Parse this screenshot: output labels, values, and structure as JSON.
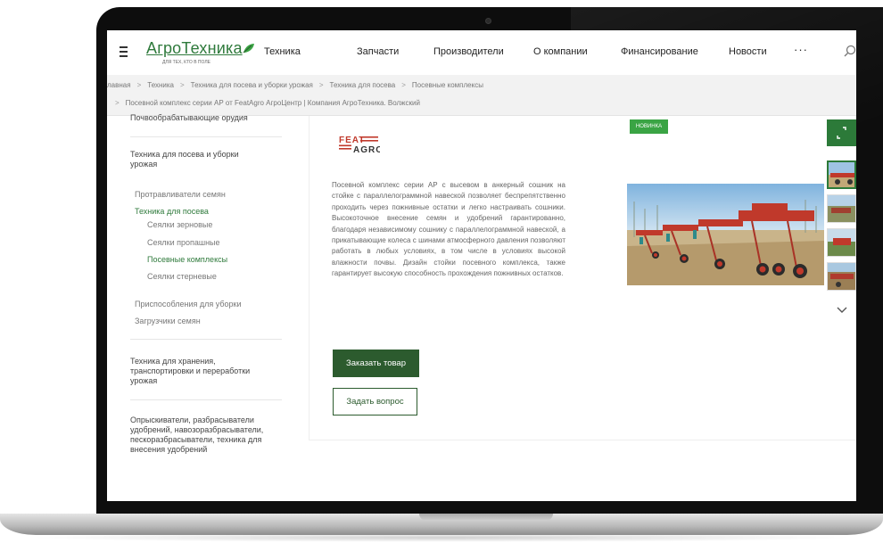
{
  "logo": {
    "name": "АгроТехника",
    "tagline": "ДЛЯ ТЕХ, КТО В ПОЛЕ"
  },
  "nav": {
    "items": [
      "Техника",
      "Запчасти",
      "Производители",
      "О компании",
      "Финансирование",
      "Новости"
    ],
    "more_label": "···"
  },
  "breadcrumbs": {
    "line1": [
      "лавная",
      "Техника",
      "Техника для посева и уборки урожая",
      "Техника для посева",
      "Посевные комплексы"
    ],
    "line2": "Посевной комплекс серии АР от FeatAgro АгроЦентр | Компания АгроТехника. Волжский"
  },
  "sidebar": {
    "top_cut": "Почвообрабатывающие орудия",
    "section1": "Техника для посева и уборки урожая",
    "section1_items": {
      "a": "Протравливатели семян",
      "b": "Техника для посева",
      "b1": "Сеялки зерновые",
      "b2": "Сеялки пропашные",
      "b3": "Посевные комплексы",
      "b4": "Сеялки стерневые",
      "c": "Приспособления для уборки",
      "d": "Загрузчики семян"
    },
    "section2": "Техника для хранения, транспортировки и переработки урожая",
    "section3": "Опрыскиватели, разбрасыватели удобрений, навозоразбрасыватели, пескоразбрасыватели, техника для внесения удобрений"
  },
  "product": {
    "brand_top": "FEAT",
    "brand_bottom": "AGRO",
    "badge": "НОВИНКА",
    "description": "Посевной комплекс серии АР с высевом в анкерный сошник на стойке с параллелограммной навеской позволяет беспрепятственно проходить через пожнивные остатки и легко настраивать сошники. Высокоточное внесение семян и удобрений гарантированно, благодаря независимому сошнику с параллелограммной навеской, а прикатывающие колеса с шинами атмосферного давления позволяют работать в любых условиях, в том числе в условиях высокой влажности почвы. Дизайн стойки посевного комплекса, также гарантирует высокую способность прохождения пожнивных остатков.",
    "order_label": "Заказать товар",
    "ask_label": "Задать вопрос"
  },
  "colors": {
    "brand_green": "#2c5b2e",
    "badge_green": "#3aa444",
    "accent_green": "#2c7a39"
  }
}
